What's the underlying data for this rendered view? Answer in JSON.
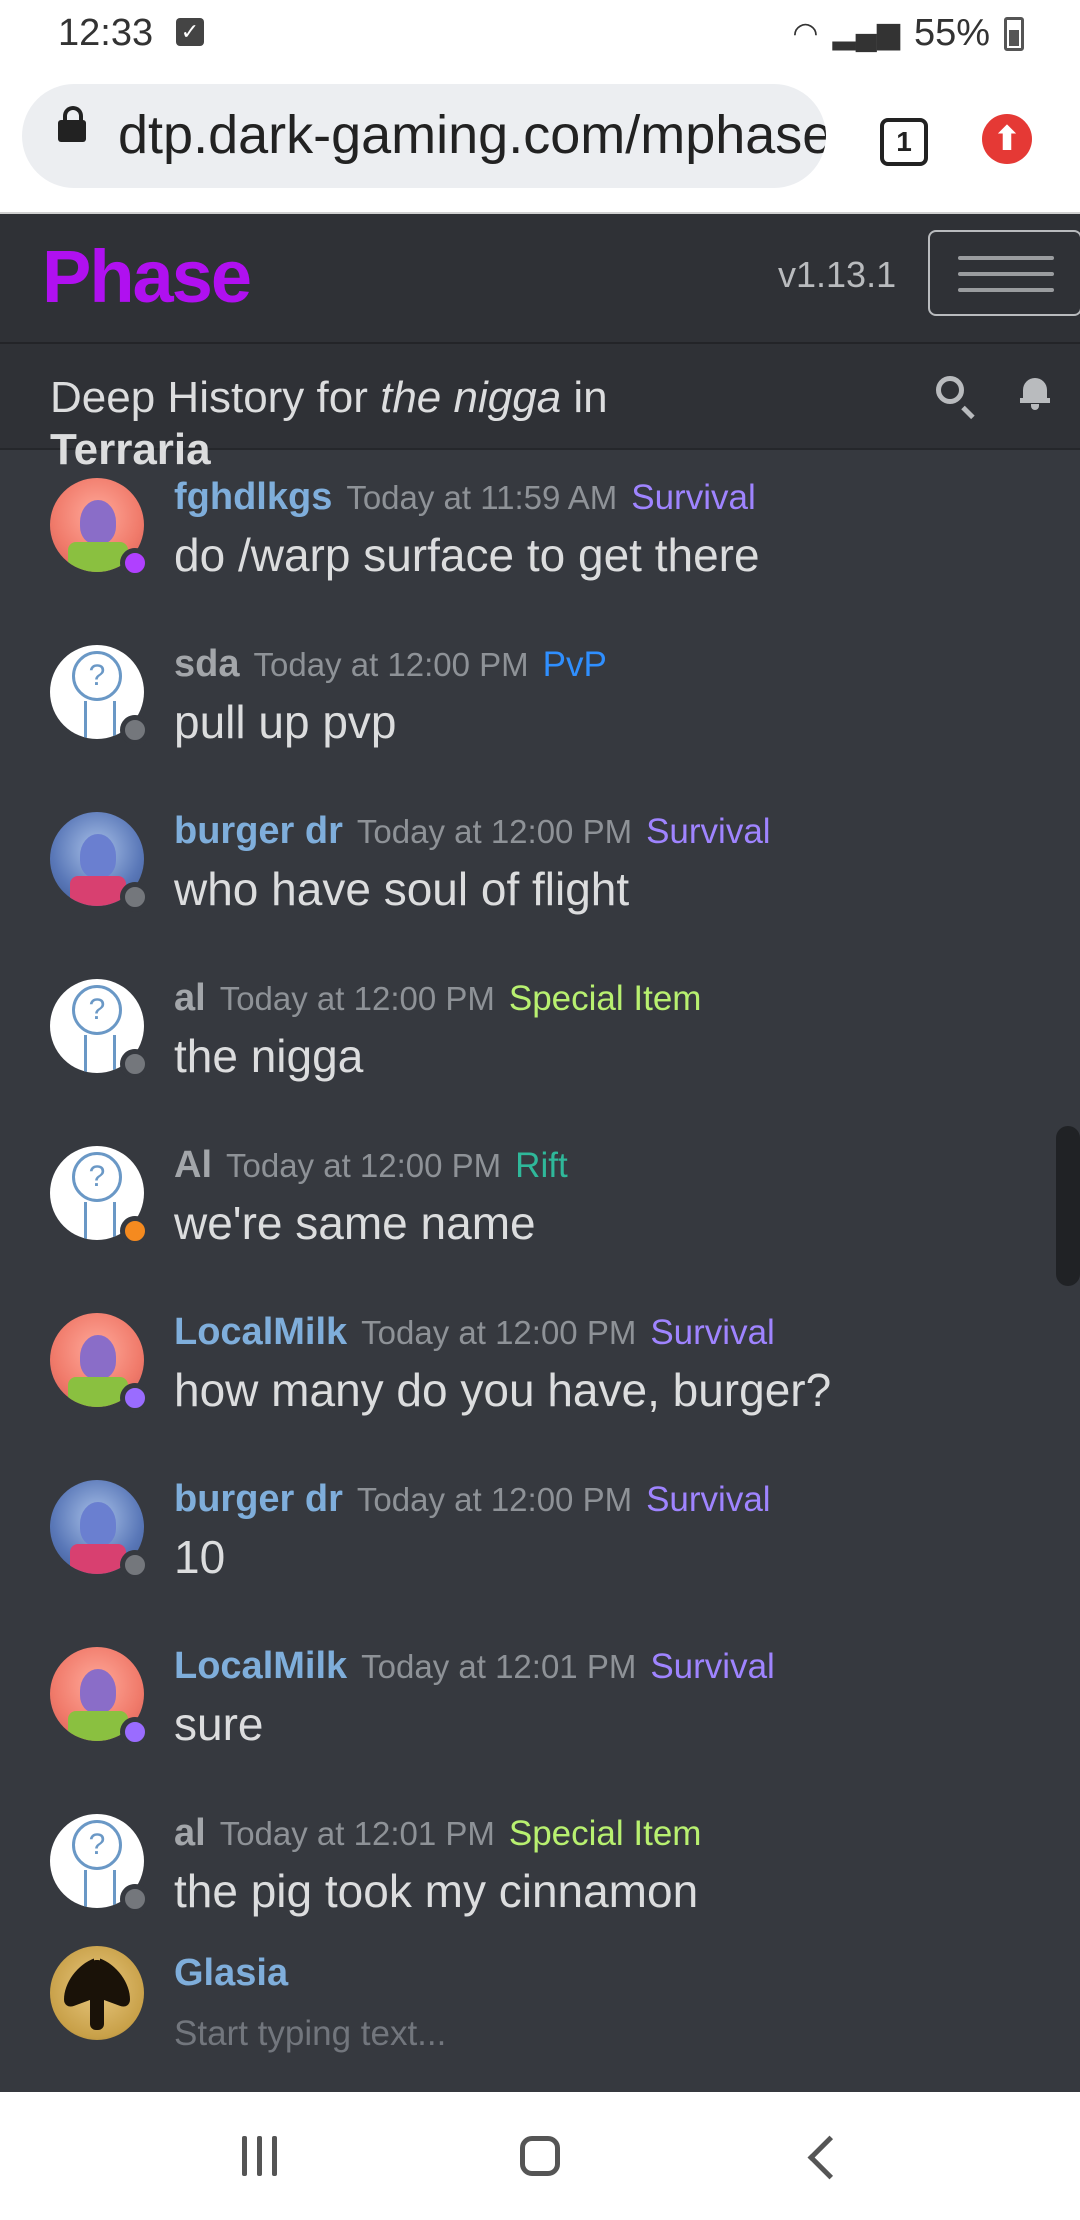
{
  "status_bar": {
    "time": "12:33",
    "battery": "55%"
  },
  "browser": {
    "url": "dtp.dark-gaming.com/mphase",
    "tab_count": "1"
  },
  "app": {
    "logo": "Phase",
    "version": "v1.13.1"
  },
  "subheader": {
    "prefix": "Deep History for ",
    "player": "the nigga",
    "in": " in",
    "game": "Terraria"
  },
  "messages": [
    {
      "user": "fghdlkgs",
      "time": "Today at 11:59 AM",
      "tag": "Survival",
      "text": "do /warp surface to get there"
    },
    {
      "user": "sda",
      "time": "Today at 12:00 PM",
      "tag": "PvP",
      "text": "pull up pvp"
    },
    {
      "user": "burger dr",
      "time": "Today at 12:00 PM",
      "tag": "Survival",
      "text": "who have soul of flight"
    },
    {
      "user": "al",
      "time": "Today at 12:00 PM",
      "tag": "Special Item",
      "text": "the nigga"
    },
    {
      "user": "Al",
      "time": "Today at 12:00 PM",
      "tag": "Rift",
      "text": "we're same name"
    },
    {
      "user": "LocalMilk",
      "time": "Today at 12:00 PM",
      "tag": "Survival",
      "text": "how many do you have, burger?"
    },
    {
      "user": "burger dr",
      "time": "Today at 12:00 PM",
      "tag": "Survival",
      "text": "10"
    },
    {
      "user": "LocalMilk",
      "time": "Today at 12:01 PM",
      "tag": "Survival",
      "text": "sure"
    },
    {
      "user": "al",
      "time": "Today at 12:01 PM",
      "tag": "Special Item",
      "text": "the pig took my cinnamon"
    }
  ],
  "composer": {
    "user": "Glasia",
    "placeholder": "Start typing text..."
  },
  "colors": {
    "survival": "#9f84ff",
    "pvp": "#2f8fff",
    "special_item": "#b8f070",
    "rift": "#2fb89a",
    "status_purple": "#b040ff",
    "status_gray": "#74777c",
    "status_orange": "#f58a1f",
    "status_violet": "#9a6cff"
  }
}
